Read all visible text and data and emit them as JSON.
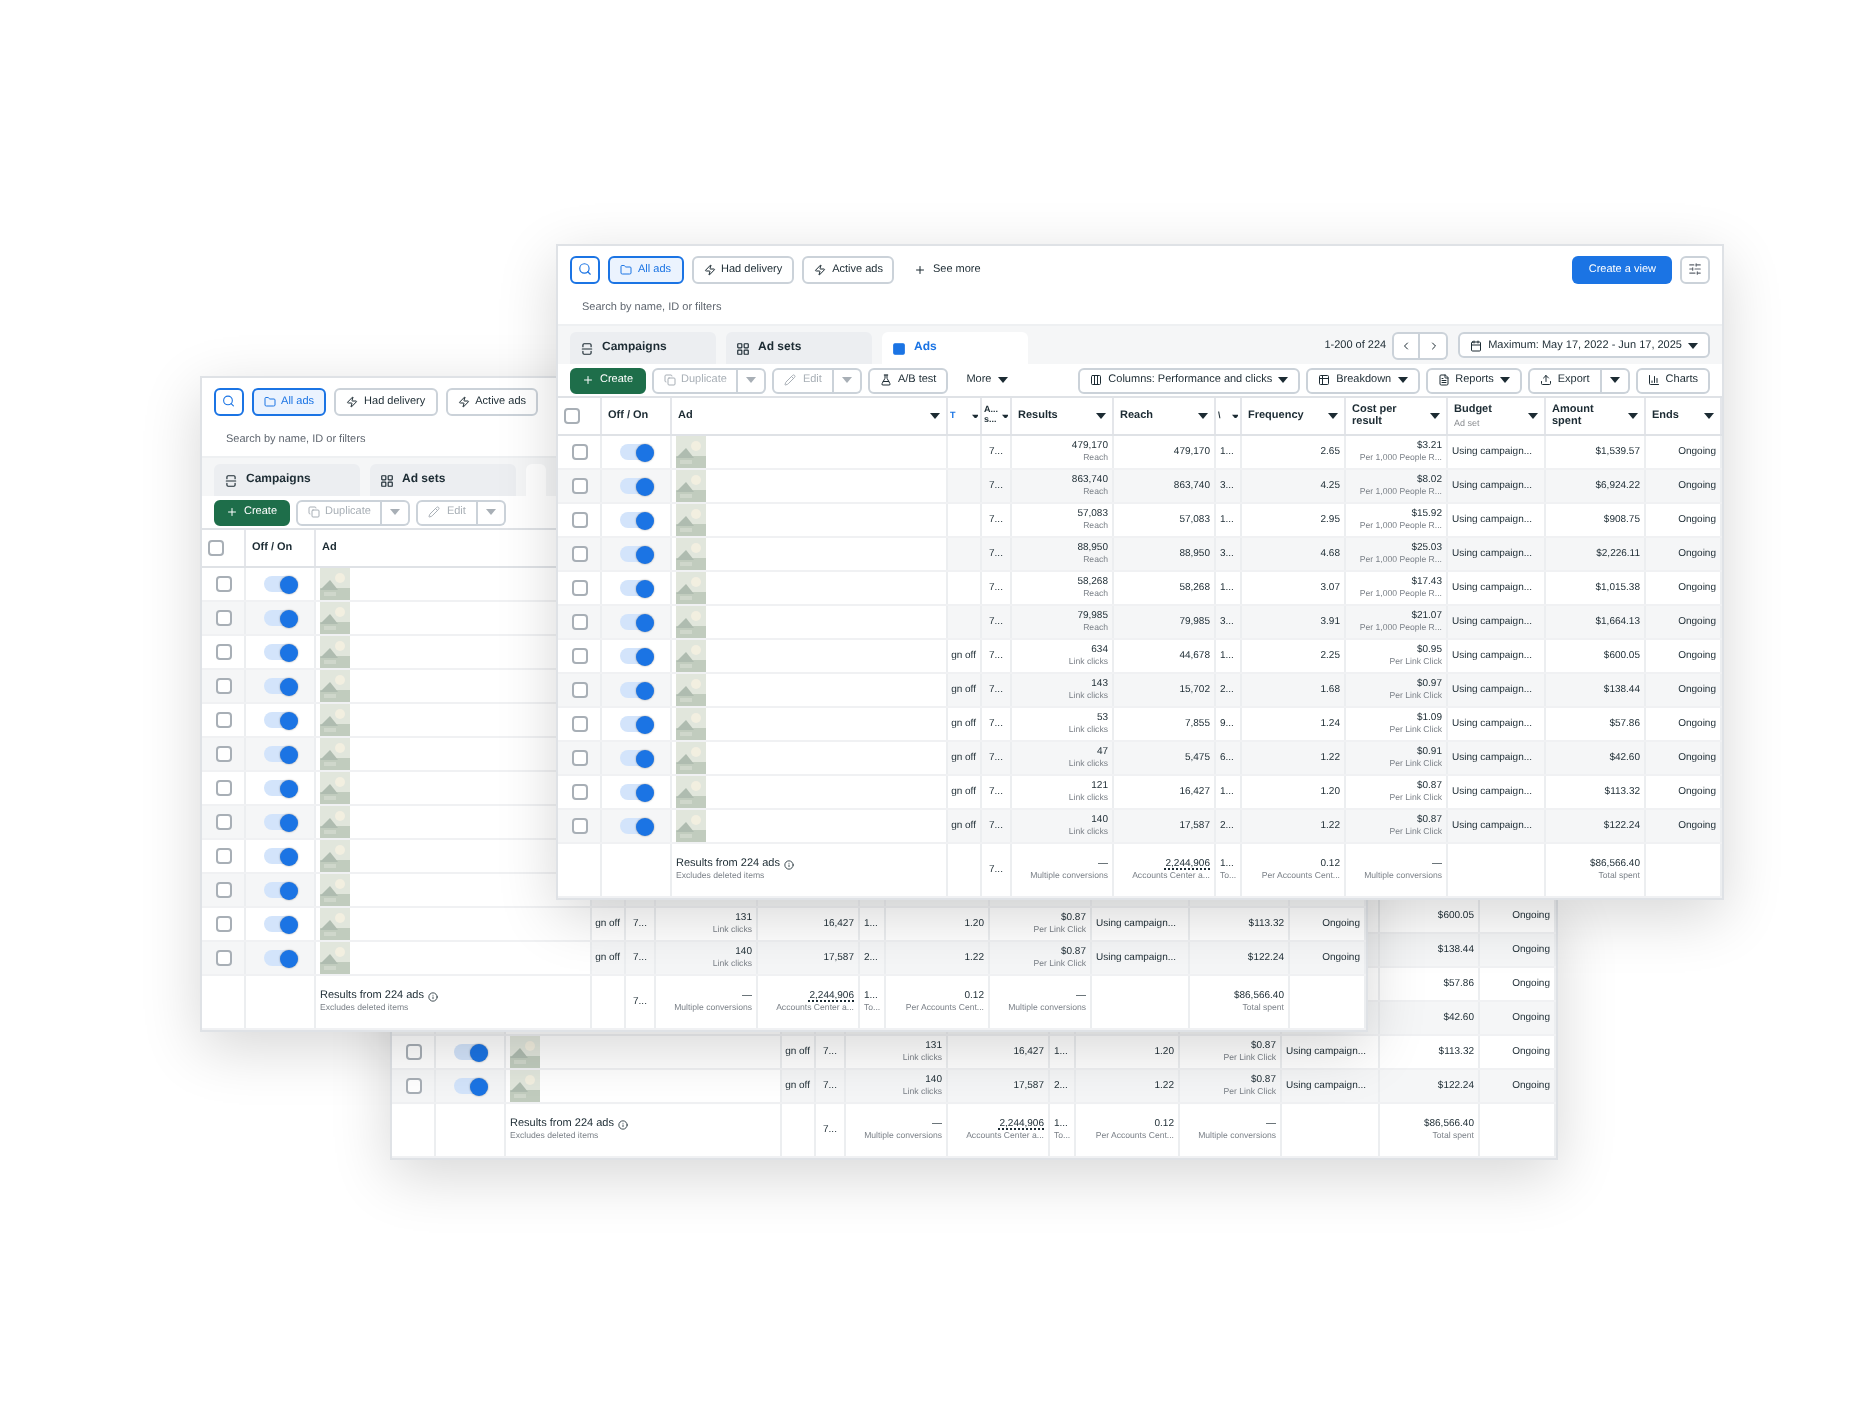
{
  "windows": [
    {
      "table": {
        "rows": [
          {
            "amount": "$600.05",
            "ends": "Ongoing"
          },
          {
            "amount": "$138.44",
            "ends": "Ongoing"
          },
          {
            "amount": "$57.86",
            "ends": "Ongoing"
          },
          {
            "amount": "$42.60",
            "ends": "Ongoing"
          },
          {
            "checked": false,
            "on": true,
            "picture": true,
            "attribution": "gn off",
            "col_a": "7...",
            "results": "131",
            "results_label": "Link clicks",
            "reach": "16,427",
            "col_8": "1...",
            "frequency": "1.20",
            "cost": "$0.87",
            "cost_label": "Per Link Click",
            "budget": "Using campaign...",
            "amount": "$113.32",
            "ends": "Ongoing"
          },
          {
            "checked": false,
            "on": true,
            "picture": true,
            "attribution": "gn off",
            "col_a": "7...",
            "results": "140",
            "results_label": "Link clicks",
            "reach": "17,587",
            "col_8": "2...",
            "frequency": "1.22",
            "cost": "$0.87",
            "cost_label": "Per Link Click",
            "budget": "Using campaign...",
            "amount": "$122.24",
            "ends": "Ongoing"
          }
        ],
        "footer": {
          "title": "Results from 224 ads",
          "note": "Excludes deleted items",
          "col_a": "7...",
          "results": "—",
          "results_label": "Multiple conversions",
          "reach": "2,244,906",
          "reach_label": "Accounts Center a...",
          "col_8": "1...",
          "col_8_label": "To...",
          "frequency": "0.12",
          "frequency_label": "Per Accounts Cent...",
          "cost": "—",
          "cost_label": "Multiple conversions",
          "amount": "$86,566.40",
          "amount_label": "Total spent"
        }
      }
    },
    {
      "filters": [
        {
          "label": "All ads",
          "selected": true
        },
        {
          "label": "Had delivery",
          "selected": false
        },
        {
          "label": "Active ads",
          "selected": false
        }
      ],
      "search": {
        "placeholder": "Search by name, ID or filters"
      },
      "tabs": [
        {
          "label": "Campaigns",
          "selected": false
        },
        {
          "label": "Ad sets",
          "selected": false
        },
        {
          "selected": true
        }
      ],
      "actions": {
        "left": [
          {
            "label": "Create",
            "kind": "primary",
            "disabled": false
          },
          {
            "label": "Duplicate",
            "kind": "split",
            "disabled": true
          },
          {
            "label": "Edit",
            "kind": "split",
            "disabled": true
          }
        ]
      },
      "table": {
        "select_all": {
          "checked": false
        },
        "columns": [
          {
            "label": "Off / On"
          },
          {
            "label": "Ad"
          }
        ],
        "rows": [
          {
            "checked": false,
            "on": true,
            "picture": true
          },
          {
            "checked": false,
            "on": true,
            "picture": true
          },
          {
            "checked": false,
            "on": true,
            "picture": true
          },
          {
            "checked": false,
            "on": true,
            "picture": true
          },
          {
            "checked": false,
            "on": true,
            "picture": true
          },
          {
            "checked": false,
            "on": true,
            "picture": true
          },
          {
            "checked": false,
            "on": true,
            "picture": true
          },
          {
            "checked": false,
            "on": true,
            "picture": true
          },
          {
            "checked": false,
            "on": true,
            "picture": true
          },
          {
            "checked": false,
            "on": true,
            "picture": true
          },
          {
            "checked": false,
            "on": true,
            "picture": true,
            "attribution": "gn off",
            "col_a": "7...",
            "results": "131",
            "results_label": "Link clicks",
            "reach": "16,427",
            "col_8": "1...",
            "frequency": "1.20",
            "cost": "$0.87",
            "cost_label": "Per Link Click",
            "budget": "Using campaign...",
            "amount": "$113.32",
            "ends": "Ongoing"
          },
          {
            "checked": false,
            "on": true,
            "picture": true,
            "attribution": "gn off",
            "col_a": "7...",
            "results": "140",
            "results_label": "Link clicks",
            "reach": "17,587",
            "col_8": "2...",
            "frequency": "1.22",
            "cost": "$0.87",
            "cost_label": "Per Link Click",
            "budget": "Using campaign...",
            "amount": "$122.24",
            "ends": "Ongoing"
          }
        ],
        "footer": {
          "title": "Results from 224 ads",
          "note": "Excludes deleted items",
          "col_a": "7...",
          "results": "—",
          "results_label": "Multiple conversions",
          "reach": "2,244,906",
          "reach_label": "Accounts Center a...",
          "col_8": "1...",
          "col_8_label": "To...",
          "frequency": "0.12",
          "frequency_label": "Per Accounts Cent...",
          "cost": "—",
          "cost_label": "Multiple conversions",
          "amount": "$86,566.40",
          "amount_label": "Total spent"
        }
      }
    },
    {
      "filters": [
        {
          "label": "All ads",
          "selected": true
        },
        {
          "label": "Had delivery",
          "selected": false
        },
        {
          "label": "Active ads",
          "selected": false
        },
        {
          "label": "See more",
          "selected": false
        }
      ],
      "create_view": "Create a view",
      "search": {
        "placeholder": "Search by name, ID or filters"
      },
      "tabs": [
        {
          "label": "Campaigns",
          "selected": false
        },
        {
          "label": "Ad sets",
          "selected": false
        },
        {
          "label": "Ads",
          "selected": true
        }
      ],
      "pagination": "1-200 of 224",
      "date_range": "Maximum: May 17, 2022 - Jun 17, 2025",
      "actions": {
        "left": [
          {
            "label": "Create",
            "kind": "primary",
            "disabled": false
          },
          {
            "label": "Duplicate",
            "kind": "split",
            "disabled": true
          },
          {
            "label": "Edit",
            "kind": "split",
            "disabled": true
          },
          {
            "label": "A/B test",
            "kind": "button",
            "disabled": false
          },
          {
            "label": "More",
            "kind": "menu",
            "disabled": false
          }
        ],
        "right": [
          {
            "label": "Columns: Performance and clicks",
            "kind": "dropdown"
          },
          {
            "label": "Breakdown",
            "kind": "dropdown"
          },
          {
            "label": "Reports",
            "kind": "dropdown"
          },
          {
            "label": "Export",
            "kind": "split"
          },
          {
            "label": "Charts",
            "kind": "button"
          }
        ]
      },
      "table": {
        "select_all": {
          "checked": false
        },
        "columns": [
          {
            "label": "Off / On"
          },
          {
            "label": "Ad"
          },
          {
            "label": "T",
            "kind": "link"
          },
          {
            "label": "A... s..."
          },
          {
            "label": "Results"
          },
          {
            "label": "Reach"
          },
          {
            "label": "\\"
          },
          {
            "label": "Frequency"
          },
          {
            "label": "Cost per result"
          },
          {
            "label": "Budget",
            "sub": "Ad set"
          },
          {
            "label": "Amount spent"
          },
          {
            "label": "Ends"
          }
        ],
        "rows": [
          {
            "checked": false,
            "on": true,
            "picture": true,
            "col_a": "7...",
            "results": "479,170",
            "results_label": "Reach",
            "reach": "479,170",
            "col_8": "1...",
            "frequency": "2.65",
            "cost": "$3.21",
            "cost_label": "Per 1,000 People R...",
            "budget": "Using campaign...",
            "amount": "$1,539.57",
            "ends": "Ongoing"
          },
          {
            "checked": false,
            "on": true,
            "picture": true,
            "col_a": "7...",
            "results": "863,740",
            "results_label": "Reach",
            "reach": "863,740",
            "col_8": "3...",
            "frequency": "4.25",
            "cost": "$8.02",
            "cost_label": "Per 1,000 People R...",
            "budget": "Using campaign...",
            "amount": "$6,924.22",
            "ends": "Ongoing"
          },
          {
            "checked": false,
            "on": true,
            "picture": true,
            "col_a": "7...",
            "results": "57,083",
            "results_label": "Reach",
            "reach": "57,083",
            "col_8": "1...",
            "frequency": "2.95",
            "cost": "$15.92",
            "cost_label": "Per 1,000 People R...",
            "budget": "Using campaign...",
            "amount": "$908.75",
            "ends": "Ongoing"
          },
          {
            "checked": false,
            "on": true,
            "picture": true,
            "col_a": "7...",
            "results": "88,950",
            "results_label": "Reach",
            "reach": "88,950",
            "col_8": "3...",
            "frequency": "4.68",
            "cost": "$25.03",
            "cost_label": "Per 1,000 People R...",
            "budget": "Using campaign...",
            "amount": "$2,226.11",
            "ends": "Ongoing"
          },
          {
            "checked": false,
            "on": true,
            "picture": true,
            "col_a": "7...",
            "results": "58,268",
            "results_label": "Reach",
            "reach": "58,268",
            "col_8": "1...",
            "frequency": "3.07",
            "cost": "$17.43",
            "cost_label": "Per 1,000 People R...",
            "budget": "Using campaign...",
            "amount": "$1,015.38",
            "ends": "Ongoing"
          },
          {
            "checked": false,
            "on": true,
            "picture": true,
            "col_a": "7...",
            "results": "79,985",
            "results_label": "Reach",
            "reach": "79,985",
            "col_8": "3...",
            "frequency": "3.91",
            "cost": "$21.07",
            "cost_label": "Per 1,000 People R...",
            "budget": "Using campaign...",
            "amount": "$1,664.13",
            "ends": "Ongoing"
          },
          {
            "checked": false,
            "on": true,
            "picture": true,
            "attribution": "gn off",
            "col_a": "7...",
            "results": "634",
            "results_label": "Link clicks",
            "reach": "44,678",
            "col_8": "1...",
            "frequency": "2.25",
            "cost": "$0.95",
            "cost_label": "Per Link Click",
            "budget": "Using campaign...",
            "amount": "$600.05",
            "ends": "Ongoing"
          },
          {
            "checked": false,
            "on": true,
            "picture": true,
            "attribution": "gn off",
            "col_a": "7...",
            "results": "143",
            "results_label": "Link clicks",
            "reach": "15,702",
            "col_8": "2...",
            "frequency": "1.68",
            "cost": "$0.97",
            "cost_label": "Per Link Click",
            "budget": "Using campaign...",
            "amount": "$138.44",
            "ends": "Ongoing"
          },
          {
            "checked": false,
            "on": true,
            "picture": true,
            "attribution": "gn off",
            "col_a": "7...",
            "results": "53",
            "results_label": "Link clicks",
            "reach": "7,855",
            "col_8": "9...",
            "frequency": "1.24",
            "cost": "$1.09",
            "cost_label": "Per Link Click",
            "budget": "Using campaign...",
            "amount": "$57.86",
            "ends": "Ongoing"
          },
          {
            "checked": false,
            "on": true,
            "picture": true,
            "attribution": "gn off",
            "col_a": "7...",
            "results": "47",
            "results_label": "Link clicks",
            "reach": "5,475",
            "col_8": "6...",
            "frequency": "1.22",
            "cost": "$0.91",
            "cost_label": "Per Link Click",
            "budget": "Using campaign...",
            "amount": "$42.60",
            "ends": "Ongoing"
          },
          {
            "checked": false,
            "on": true,
            "picture": true,
            "attribution": "gn off",
            "col_a": "7...",
            "results": "121",
            "results_label": "Link clicks",
            "reach": "16,427",
            "col_8": "1...",
            "frequency": "1.20",
            "cost": "$0.87",
            "cost_label": "Per Link Click",
            "budget": "Using campaign...",
            "amount": "$113.32",
            "ends": "Ongoing"
          },
          {
            "checked": false,
            "on": true,
            "picture": true,
            "attribution": "gn off",
            "col_a": "7...",
            "results": "140",
            "results_label": "Link clicks",
            "reach": "17,587",
            "col_8": "2...",
            "frequency": "1.22",
            "cost": "$0.87",
            "cost_label": "Per Link Click",
            "budget": "Using campaign...",
            "amount": "$122.24",
            "ends": "Ongoing"
          }
        ],
        "footer": {
          "title": "Results from 224 ads",
          "note": "Excludes deleted items",
          "col_a": "7...",
          "results": "—",
          "results_label": "Multiple conversions",
          "reach": "2,244,906",
          "reach_label": "Accounts Center a...",
          "col_8": "1...",
          "col_8_label": "To...",
          "frequency": "0.12",
          "frequency_label": "Per Accounts Cent...",
          "cost": "—",
          "cost_label": "Multiple conversions",
          "amount": "$86,566.40",
          "amount_label": "Total spent"
        }
      }
    }
  ]
}
